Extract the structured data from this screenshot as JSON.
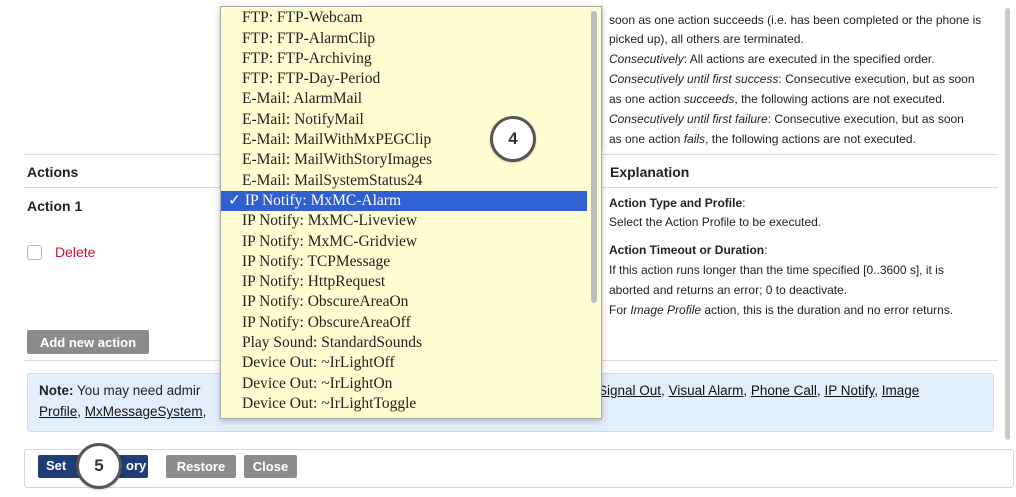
{
  "explanation_top": {
    "line1": "soon as one action succeeds (i.e. has been completed or the phone is",
    "line2": "picked up), all others are terminated.",
    "consec_label": "Consecutively",
    "consec_text": ": All actions are executed in the specified order.",
    "success_label": "Consecutively until first success",
    "success_text": ": Consecutive execution, but as soon",
    "succeeds_pre": "as one action ",
    "succeeds_word": "succeeds",
    "succeeds_post": ", the following actions are not executed.",
    "failure_label": "Consecutively until first failure",
    "failure_text": ": Consecutive execution, but as soon",
    "fails_pre": "as one action ",
    "fails_word": "fails",
    "fails_post": ", the following actions are not executed."
  },
  "table": {
    "actions_header": "Actions",
    "explanation_header": "Explanation",
    "action_label": "Action 1",
    "delete_label": "Delete",
    "add_button": "Add new action"
  },
  "explanation_action": {
    "type_title": "Action Type and Profile",
    "type_colon": ":",
    "type_text": "Select the Action Profile to be executed.",
    "timeout_title": "Action Timeout or Duration",
    "timeout_colon": ":",
    "timeout_l1": "If this action runs longer than the time specified [0..3600 s], it is",
    "timeout_l2": "aborted and returns an error; 0 to deactivate.",
    "for_pre": "For ",
    "for_italic": "Image Profile",
    "for_post": " action, this is the duration and no error returns."
  },
  "note": {
    "label": "Note:",
    "text": " You may need admir",
    "link_signal_out": "Signal Out",
    "link_visual_alarm": "Visual Alarm",
    "link_phone_call": "Phone Call",
    "link_ip_notify": "IP Notify",
    "link_image": "Image",
    "link_profile": "Profile",
    "link_mxmessage": "MxMessageSystem"
  },
  "bottom": {
    "set_label": "Set",
    "factory_label": "ory",
    "restore_label": "Restore",
    "close_label": "Close"
  },
  "dropdown": {
    "options": [
      "FTP: FTP-Webcam",
      "FTP: FTP-AlarmClip",
      "FTP: FTP-Archiving",
      "FTP: FTP-Day-Period",
      "E-Mail: AlarmMail",
      "E-Mail: NotifyMail",
      "E-Mail: MailWithMxPEGClip",
      "E-Mail: MailWithStoryImages",
      "E-Mail: MailSystemStatus24",
      "✓ IP Notify: MxMC-Alarm",
      "IP Notify: MxMC-Liveview",
      "IP Notify: MxMC-Gridview",
      "IP Notify: TCPMessage",
      "IP Notify: HttpRequest",
      "IP Notify: ObscureAreaOn",
      "IP Notify: ObscureAreaOff",
      "Play Sound: StandardSounds",
      "Device Out: ~IrLightOff",
      "Device Out: ~IrLightOn",
      "Device Out: ~IrLightToggle"
    ]
  },
  "callouts": {
    "four": "4",
    "five": "5"
  },
  "colors": {
    "dropdown_bg": "#fdfdd2",
    "selected": "#2f5fd0",
    "delete_red": "#c8102e",
    "note_bg": "#e3eefc",
    "primary_blue": "#1f3e78"
  }
}
